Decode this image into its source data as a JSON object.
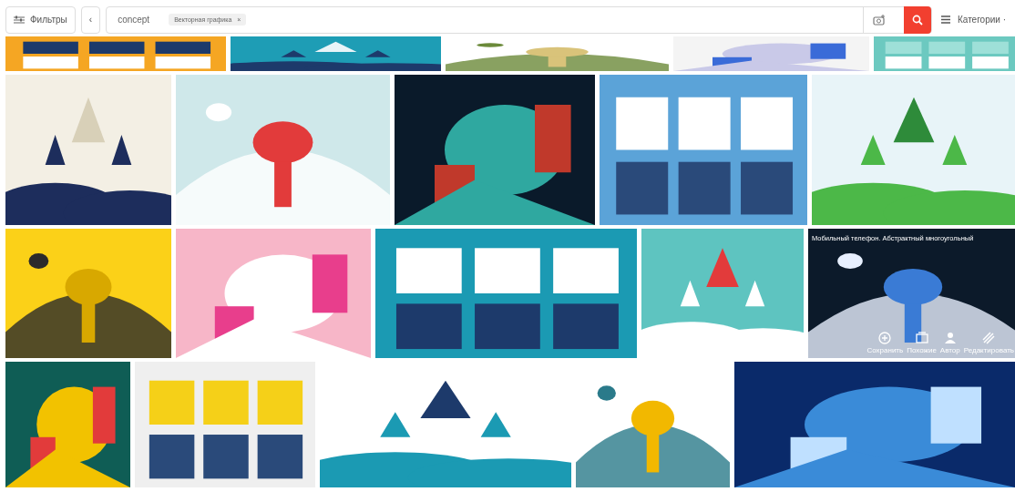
{
  "toolbar": {
    "filters_label": "Фильтры",
    "collapse": "‹",
    "query": "concept",
    "chips": [
      {
        "label": "Векторная графика",
        "remove": "×"
      }
    ],
    "categories_label": "Категории ·"
  },
  "results": [
    [
      {
        "kind": "picture"
      },
      {
        "kind": "picture"
      },
      {
        "kind": "picture"
      },
      {
        "kind": "picture"
      },
      {
        "kind": "picture"
      }
    ],
    [
      {
        "kind": "picture"
      },
      {
        "kind": "picture"
      },
      {
        "kind": "picture"
      },
      {
        "kind": "picture"
      },
      {
        "kind": "picture"
      }
    ],
    [
      {
        "kind": "picture"
      },
      {
        "kind": "picture"
      },
      {
        "kind": "picture"
      },
      {
        "kind": "picture"
      },
      {
        "kind": "picture",
        "overlay": {
          "title": "Мобильный телефон. Абстрактный многоугольный",
          "actions": [
            "Сохранить",
            "Похожие",
            "Автор",
            "Редактировать"
          ]
        }
      }
    ],
    [
      {
        "kind": "picture"
      },
      {
        "kind": "picture"
      },
      {
        "kind": "picture"
      },
      {
        "kind": "picture"
      },
      {
        "kind": "picture"
      }
    ]
  ]
}
